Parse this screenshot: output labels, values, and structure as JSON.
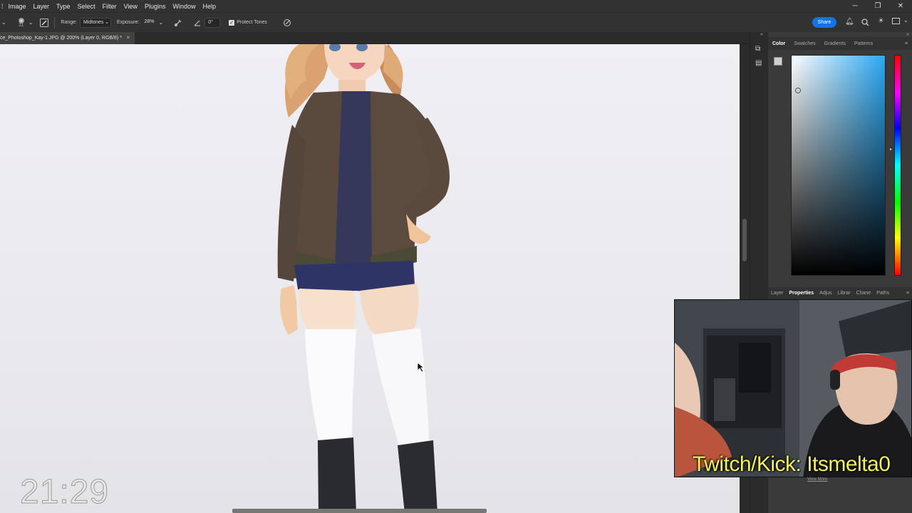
{
  "menu": [
    "Image",
    "Layer",
    "Type",
    "Select",
    "Filter",
    "View",
    "Plugins",
    "Window",
    "Help"
  ],
  "options": {
    "brush_size": "21",
    "range_label": "Range:",
    "range_value": "Midtones",
    "exposure_label": "Exposure:",
    "exposure_value": "28%",
    "angle_value": "0°",
    "protect_tones": "Protect Tones"
  },
  "share_label": "Share",
  "document_tab": "ce_Photoshop_Kay-1.JPG @ 200% (Layer 0, RGB/8) *",
  "color_panel": {
    "tabs": [
      "Color",
      "Swatches",
      "Gradients",
      "Patterns"
    ],
    "active": "Color"
  },
  "properties_panel": {
    "tabs": [
      "Layer",
      "Properties",
      "Adjus",
      "Librar",
      "Chane",
      "Paths"
    ],
    "active": "Properties"
  },
  "webcam_overlay": "Twitch/Kick: Itsmelta0",
  "view_more": "View More",
  "timer": "21:29",
  "colors": {
    "accent": "#1473e6",
    "overlay_text": "#f2f260",
    "ui_dark": "#323232"
  }
}
